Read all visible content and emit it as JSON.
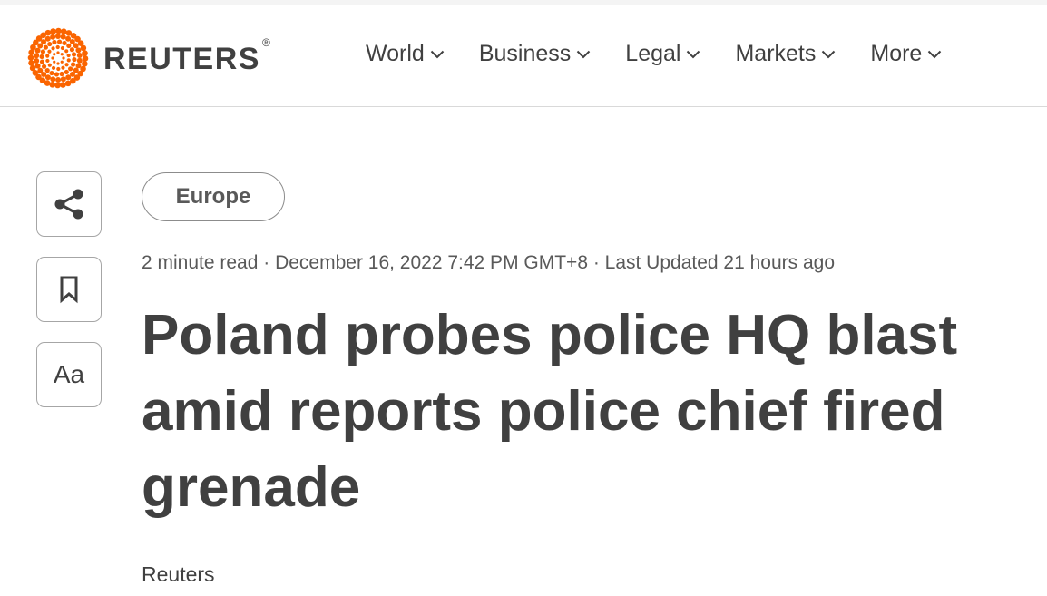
{
  "brand": {
    "name": "REUTERS",
    "registered_mark": "®",
    "accent_color": "#fa6400"
  },
  "nav": {
    "items": [
      {
        "label": "World",
        "icon": "chevron-down-icon"
      },
      {
        "label": "Business",
        "icon": "chevron-down-icon"
      },
      {
        "label": "Legal",
        "icon": "chevron-down-icon"
      },
      {
        "label": "Markets",
        "icon": "chevron-down-icon"
      },
      {
        "label": "More",
        "icon": "chevron-down-icon"
      }
    ]
  },
  "sidebar": {
    "share_icon": "share-icon",
    "bookmark_icon": "bookmark-icon",
    "text_size_label": "Aa"
  },
  "article": {
    "section": "Europe",
    "meta": "2 minute read · December 16, 2022 7:42 PM GMT+8 · Last Updated 21 hours ago",
    "headline": "Poland probes police HQ blast amid reports police chief fired grenade",
    "byline": "Reuters"
  }
}
